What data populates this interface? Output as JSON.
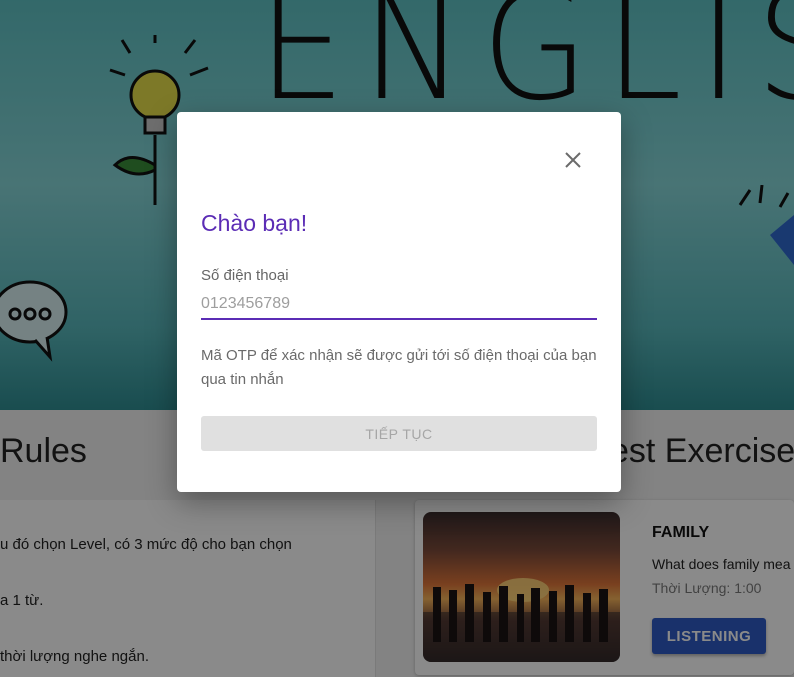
{
  "hero": {
    "word": "ENGLISH"
  },
  "sections": {
    "rules_title": "Rules",
    "exercise_title": "est Exercise"
  },
  "rules": {
    "lines": [
      "u đó chọn Level, có 3 mức độ cho bạn chọn",
      "a 1 từ.",
      "thời lượng nghe ngắn."
    ]
  },
  "exercise": {
    "title": "FAMILY",
    "description": "What does family mea",
    "duration": "Thời Lượng: 1:00",
    "button_label": "LISTENING"
  },
  "dialog": {
    "close_icon": "close-icon",
    "title": "Chào bạn!",
    "field_label": "Số điện thoại",
    "phone_placeholder": "0123456789",
    "phone_value": "",
    "otp_note": "Mã OTP để xác nhận sẽ được gửi tới số điện thoại của bạn qua tin nhắn",
    "continue_label": "TIẾP TỤC"
  },
  "colors": {
    "accent": "#5b2cb5",
    "primary_button": "#2f5cc6",
    "disabled_button": "#e0e0e0"
  }
}
